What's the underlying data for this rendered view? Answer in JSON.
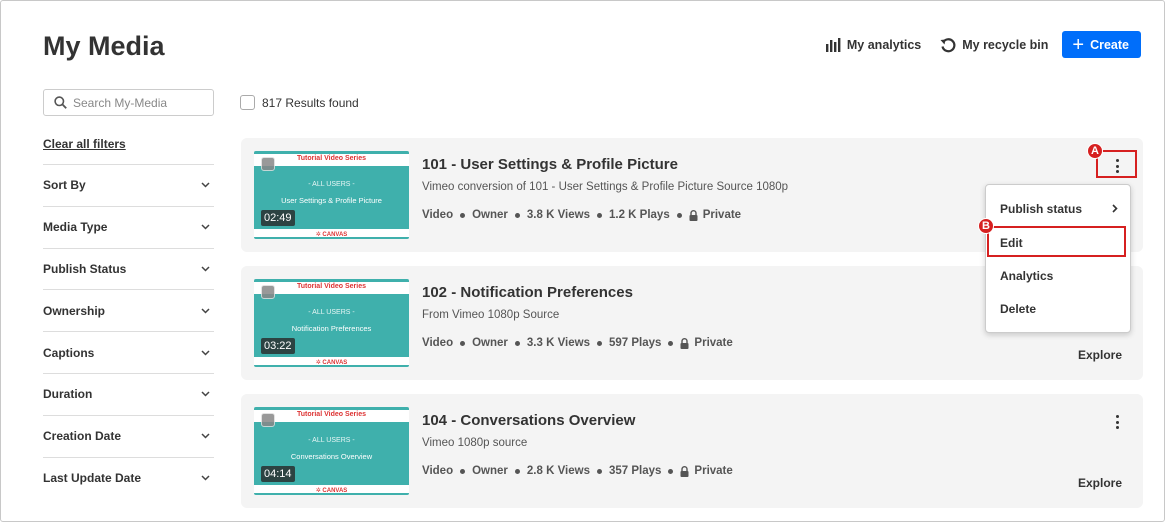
{
  "header": {
    "title": "My Media",
    "analytics_label": "My analytics",
    "recycle_label": "My recycle bin",
    "create_label": "Create"
  },
  "search": {
    "placeholder": "Search My-Media"
  },
  "results": {
    "label": "817 Results found"
  },
  "filters": {
    "clear_label": "Clear all filters",
    "items": [
      {
        "label": "Sort By"
      },
      {
        "label": "Media Type"
      },
      {
        "label": "Publish Status"
      },
      {
        "label": "Ownership"
      },
      {
        "label": "Captions"
      },
      {
        "label": "Duration"
      },
      {
        "label": "Creation Date"
      },
      {
        "label": "Last Update Date"
      }
    ]
  },
  "thumbnail": {
    "series": "Tutorial Video Series",
    "audience": "- ALL USERS -",
    "logo": "CANVAS"
  },
  "media": [
    {
      "title": "101 - User Settings & Profile Picture",
      "description": "Vimeo conversion of 101 - User Settings & Profile Picture Source 1080p",
      "topic": "User Settings & Profile Picture",
      "duration": "02:49",
      "type": "Video",
      "role": "Owner",
      "views": "3.8 K Views",
      "plays": "1.2 K Plays",
      "privacy": "Private"
    },
    {
      "title": "102 - Notification Preferences",
      "description": "From Vimeo 1080p Source",
      "topic": "Notification Preferences",
      "duration": "03:22",
      "type": "Video",
      "role": "Owner",
      "views": "3.3 K Views",
      "plays": "597 Plays",
      "privacy": "Private",
      "explore": "Explore"
    },
    {
      "title": "104 - Conversations Overview",
      "description": "Vimeo 1080p source",
      "topic": "Conversations Overview",
      "duration": "04:14",
      "type": "Video",
      "role": "Owner",
      "views": "2.8 K Views",
      "plays": "357 Plays",
      "privacy": "Private",
      "explore": "Explore"
    }
  ],
  "context_menu": {
    "items": [
      {
        "label": "Publish status"
      },
      {
        "label": "Edit"
      },
      {
        "label": "Analytics"
      },
      {
        "label": "Delete"
      }
    ]
  },
  "annotations": {
    "a": "A",
    "b": "B"
  },
  "colors": {
    "accent": "#006efa",
    "highlight": "#d62020",
    "thumb": "#3fb0ac"
  }
}
